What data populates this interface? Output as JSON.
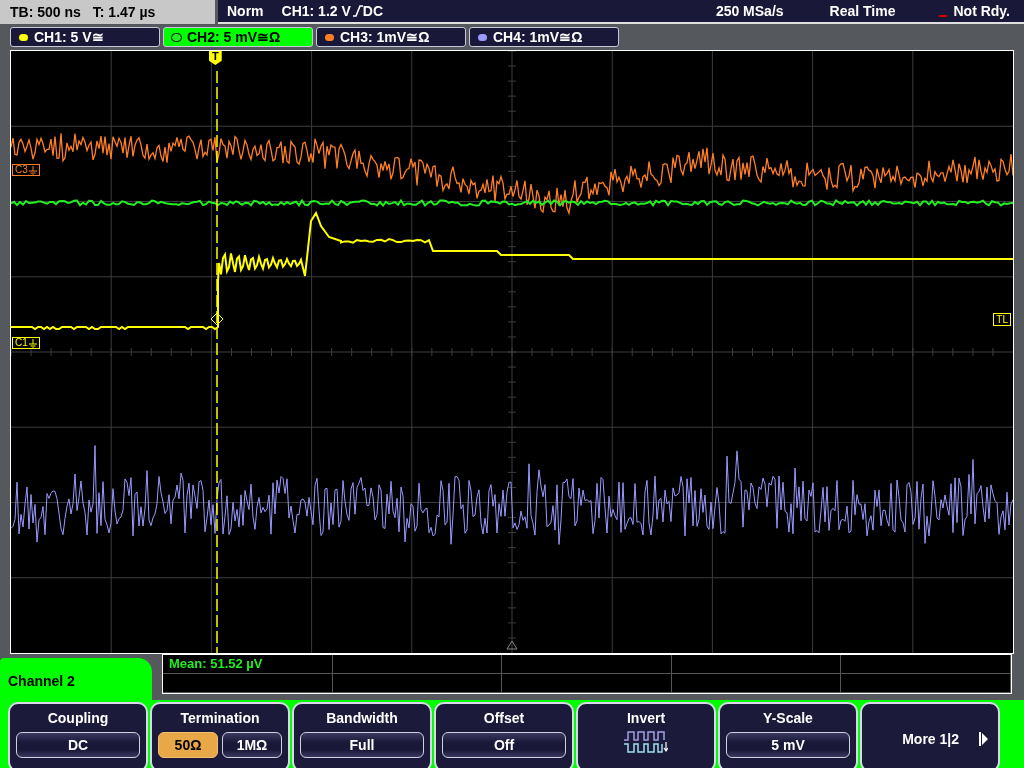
{
  "top_bar": {
    "timebase": "TB: 500 ns",
    "trigger_time": "T: 1.47 µs",
    "trigger_mode": "Norm",
    "trigger_level": "CH1: 1.2 V",
    "trigger_coupling": "DC",
    "sample_rate": "250 MSa/s",
    "acquisition": "Real Time",
    "status": "Not Rdy."
  },
  "channels": [
    {
      "label": "CH1: 5 V≅",
      "color": "#ffff00",
      "selected": false
    },
    {
      "label": "CH2: 5 mV≅Ω",
      "color": "#22ee22",
      "selected": true
    },
    {
      "label": "CH3: 1mV≅Ω",
      "color": "#ff7f27",
      "selected": false
    },
    {
      "label": "CH4: 1mV≅Ω",
      "color": "#9a9aff",
      "selected": false
    }
  ],
  "markers": [
    {
      "label": "C3",
      "color": "#ff7f27"
    },
    {
      "label": "C1",
      "color": "#ffff00"
    }
  ],
  "trigger_markers": {
    "top": "T",
    "level": "TL"
  },
  "measurements": [
    "Mean: 51.52 µV"
  ],
  "menu": {
    "title": "Channel 2",
    "softkeys": [
      {
        "kind": "select",
        "label": "Coupling",
        "value": "DC"
      },
      {
        "kind": "toggle",
        "label": "Termination",
        "options": [
          {
            "label": "50Ω",
            "selected": true
          },
          {
            "label": "1MΩ",
            "selected": false
          }
        ]
      },
      {
        "kind": "select",
        "label": "Bandwidth",
        "value": "Full"
      },
      {
        "kind": "select",
        "label": "Offset",
        "value": "Off"
      },
      {
        "kind": "icon",
        "label": "Invert"
      },
      {
        "kind": "select",
        "label": "Y-Scale",
        "value": "5 mV"
      },
      {
        "kind": "more",
        "label": "More 1|2"
      }
    ]
  }
}
